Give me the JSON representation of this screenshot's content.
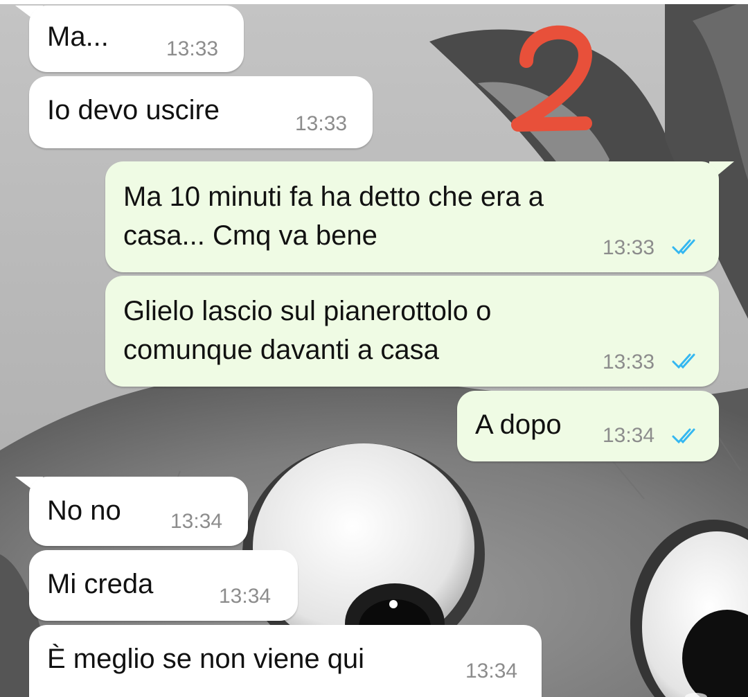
{
  "conversation": {
    "overlay_mark": "2",
    "messages": [
      {
        "direction": "incoming",
        "text": "Ma...",
        "time": "13:33"
      },
      {
        "direction": "incoming",
        "text": "Io devo uscire",
        "time": "13:33"
      },
      {
        "direction": "outgoing",
        "text_line1": "Ma 10 minuti fa ha detto che era a",
        "text_line2": "casa... Cmq va bene",
        "time": "13:33",
        "status": "read"
      },
      {
        "direction": "outgoing",
        "text_line1": "Glielo lascio sul pianerottolo o",
        "text_line2": "comunque davanti a casa",
        "time": "13:33",
        "status": "read"
      },
      {
        "direction": "outgoing",
        "text": "A dopo",
        "time": "13:34",
        "status": "read"
      },
      {
        "direction": "incoming",
        "text": "No no",
        "time": "13:34"
      },
      {
        "direction": "incoming",
        "text": "Mi creda",
        "time": "13:34"
      },
      {
        "direction": "incoming",
        "text": "È meglio se non viene qui",
        "time": "13:34"
      }
    ]
  },
  "colors": {
    "incoming_bubble": "#ffffff",
    "outgoing_bubble": "#effbe4",
    "read_ticks": "#34b7f1",
    "timestamp": "#8c8c8c",
    "overlay_mark": "#e8503a"
  },
  "icons": {
    "read_receipt": "double-check-icon"
  }
}
